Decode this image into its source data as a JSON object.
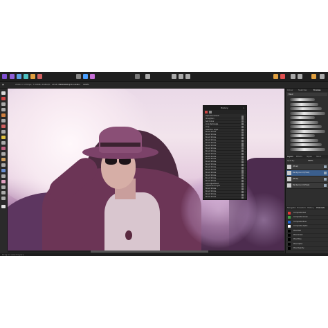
{
  "app": {
    "context_bar": {
      "document_label": "2000 × 1333px, 7.59MB, RGBA/8 - sRGB IEC61966-2.1",
      "extra_label": "Not Anonymous 8",
      "zoom_label": "Scale",
      "zoom_value": "100%"
    },
    "personas": [
      {
        "name": "photo-persona-icon",
        "color": "#8f5fd6"
      },
      {
        "name": "liquify-persona-icon",
        "color": "#5aa0e0"
      },
      {
        "name": "develop-persona-icon",
        "color": "#4cc0c0"
      },
      {
        "name": "tone-map-persona-icon",
        "color": "#e0a040"
      },
      {
        "name": "export-persona-icon",
        "color": "#d06060"
      }
    ],
    "status_text": "Drag to select layers."
  },
  "history_panel": {
    "title": "History",
    "rows": [
      "Open Document",
      "Straighten",
      "Set Colour",
      "Crop Rectangle",
      "Crop",
      "Selection Layer",
      "Brush Stroke",
      "Brush Stroke",
      "Brush Stroke",
      "Brush Stroke",
      "Brush Stroke",
      "Brush Stroke",
      "Brush Stroke",
      "Brush Stroke",
      "Brush Stroke",
      "Brush Stroke",
      "Brush Stroke",
      "Brush Stroke",
      "Brush Stroke",
      "Brush Stroke",
      "Brush Stroke",
      "Brush Stroke",
      "Brush Stroke",
      "Brush Stroke",
      "Brush Stroke",
      "Add Adjustment",
      "Adjustment Layer",
      "Brush Stroke",
      "Brush Stroke",
      "Brush Stroke",
      "Brush Stroke"
    ]
  },
  "brushes_panel": {
    "tabs": [
      "Colour",
      "Swatches",
      "Brushes"
    ],
    "category": "Basic"
  },
  "layers_panel": {
    "tabs": [
      "Layers",
      "Effects",
      "Styles",
      "Stock"
    ],
    "opacity_label": "Opacity:",
    "opacity_value": "100%",
    "layers": [
      {
        "label": "(Pixel)",
        "selected": false
      },
      {
        "label": "Background (Pixel)",
        "selected": true
      },
      {
        "label": "(Pixel)",
        "selected": false
      },
      {
        "label": "Background (Pixel)",
        "selected": false
      }
    ]
  },
  "swatch_panel": {
    "tabs": [
      "Navigator",
      "Transform",
      "History",
      "Channels"
    ],
    "rows": [
      {
        "label": "Composite Red",
        "color": "#e53935"
      },
      {
        "label": "Composite Green",
        "color": "#43a047"
      },
      {
        "label": "Composite Blue",
        "color": "#1e63d6"
      },
      {
        "label": "Composite Alpha",
        "color": "#ffffff"
      },
      {
        "label": "Pixel Red",
        "color": "#000000"
      },
      {
        "label": "Pixel Green",
        "color": "#000000"
      },
      {
        "label": "Pixel Blue",
        "color": "#000000"
      },
      {
        "label": "Pixel Alpha",
        "color": "#000000"
      },
      {
        "label": "Pixel Opacity",
        "color": "#000000"
      }
    ]
  }
}
